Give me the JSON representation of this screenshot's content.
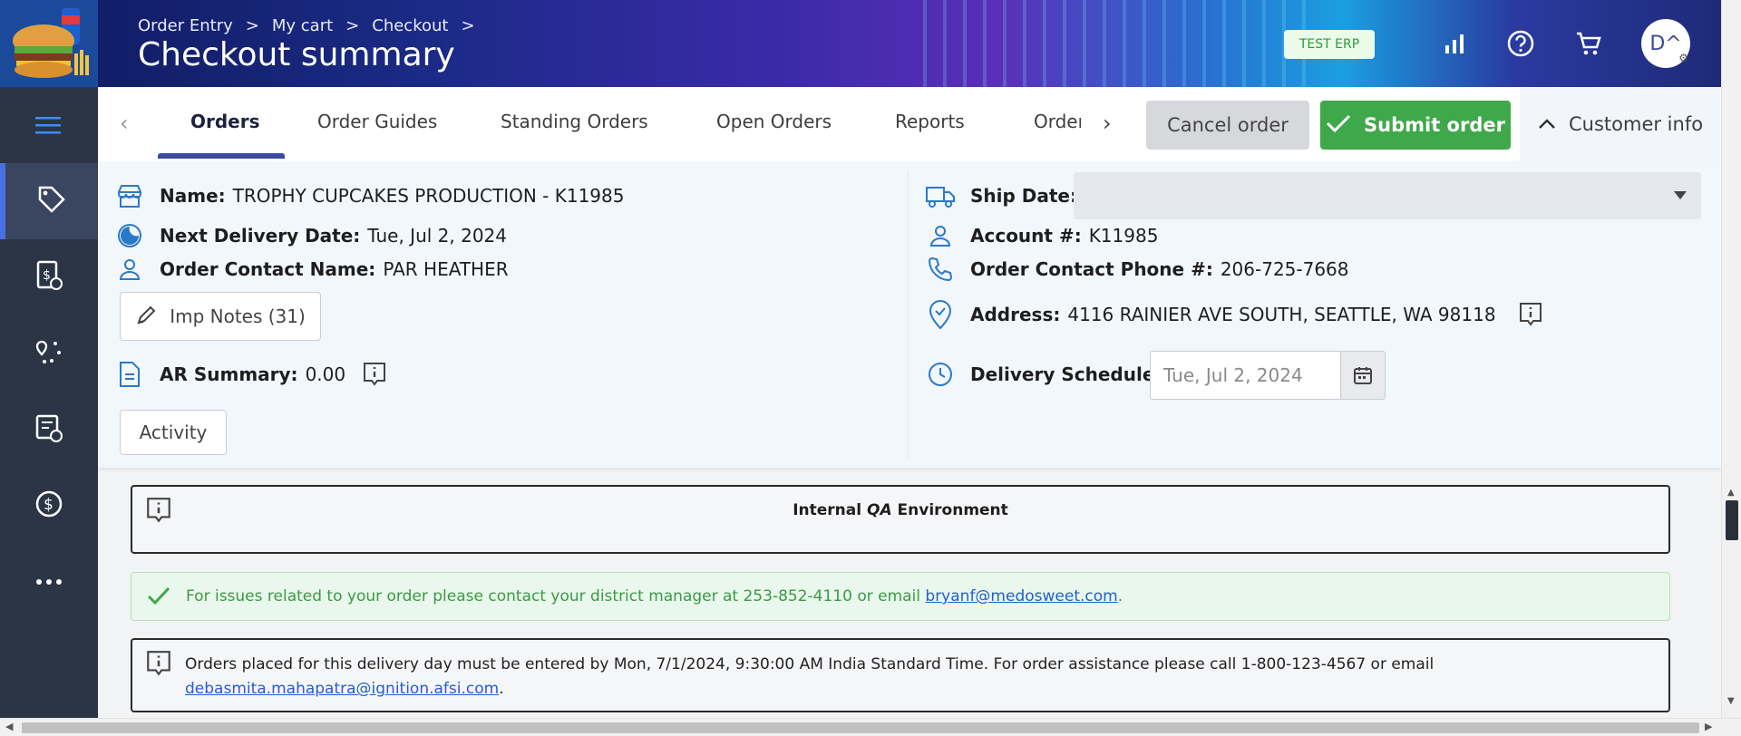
{
  "header": {
    "breadcrumb": [
      "Order Entry",
      "My cart",
      "Checkout"
    ],
    "breadcrumb_sep": ">",
    "title": "Checkout summary",
    "env_badge": "TEST ERP",
    "avatar_text": "D^",
    "icons": [
      "reports-icon",
      "help-icon",
      "cart-icon"
    ]
  },
  "sidebar": {
    "items": [
      "menu-icon",
      "tag-icon",
      "invoice-icon",
      "route-icon",
      "receipt-icon",
      "payments-icon",
      "more-icon"
    ]
  },
  "tabs": {
    "items": [
      "Orders",
      "Order Guides",
      "Standing Orders",
      "Open Orders",
      "Reports",
      "Order"
    ],
    "active": "Orders"
  },
  "actions": {
    "cancel": "Cancel order",
    "submit": "Submit order",
    "customer_info": "Customer info"
  },
  "customer": {
    "name_label": "Name:",
    "name": "TROPHY CUPCAKES PRODUCTION - K11985",
    "next_delivery_label": "Next Delivery Date:",
    "next_delivery": "Tue, Jul 2, 2024",
    "contact_label": "Order Contact Name:",
    "contact": "PAR HEATHER",
    "imp_notes": "Imp Notes (31)",
    "ar_label": "AR Summary:",
    "ar_value": "0.00",
    "activity": "Activity",
    "ship_label": "Ship Date:",
    "ship_value": "",
    "account_label": "Account #:",
    "account": "K11985",
    "phone_label": "Order Contact Phone #:",
    "phone": "206-725-7668",
    "address_label": "Address:",
    "address": "4116 RAINIER AVE SOUTH, SEATTLE, WA 98118",
    "schedule_label": "Delivery Schedule:",
    "schedule_value": "Tue, Jul 2, 2024"
  },
  "messages": {
    "qa_prefix": "Internal ",
    "qa_italic": "QA",
    "qa_suffix": " Environment",
    "green_text": "For issues related to your order please contact your district manager at 253-852-4110 or email ",
    "green_link": "bryanf@medosweet.com",
    "green_end": ".",
    "note_text": "Orders placed for this delivery day must be entered by Mon, 7/1/2024, 9:30:00 AM India Standard Time. For order assistance please call 1-800-123-4567 or email ",
    "note_link": "debasmita.mahapatra@ignition.afsi.com",
    "note_end": "."
  },
  "colors": {
    "accent": "#3a4aa0",
    "submit": "#3fa84a",
    "sidebar": "#2b3545",
    "icon_blue": "#2a79c8"
  }
}
